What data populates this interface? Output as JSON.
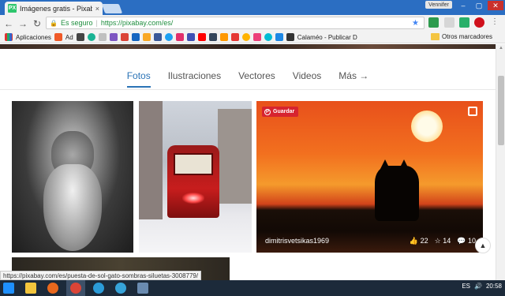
{
  "browser": {
    "tab_title": "Imágenes gratis - Pixaba",
    "tab_favicon": "PX",
    "tab_close": "×",
    "user_name": "Vennifer",
    "address": {
      "security_label": "Es seguro",
      "url": "https://pixabay.com/es/"
    }
  },
  "bookmarks": {
    "apps_label": "Aplicaciones",
    "ad_label": "Ad",
    "calameo_label": "Calaméo - Publicar D",
    "other_label": "Otros marcadores"
  },
  "site": {
    "nav": [
      {
        "label": "Fotos"
      },
      {
        "label": "Ilustraciones"
      },
      {
        "label": "Vectores"
      },
      {
        "label": "Videos"
      },
      {
        "label": "Más →"
      }
    ],
    "featured": {
      "save_label": "Guardar",
      "author": "dimitrisvetsikas1969",
      "likes": "22",
      "favorites": "14",
      "comments": "10"
    }
  },
  "status_url": "https://pixabay.com/es/puesta-de-sol-gato-sombras-siluetas-3008779/",
  "taskbar": {
    "clock": "20:58",
    "lang": "ES"
  },
  "colors": {
    "accent": "#2a73b6",
    "save": "#d7242f",
    "tab_bar": "#2b6ec2"
  }
}
